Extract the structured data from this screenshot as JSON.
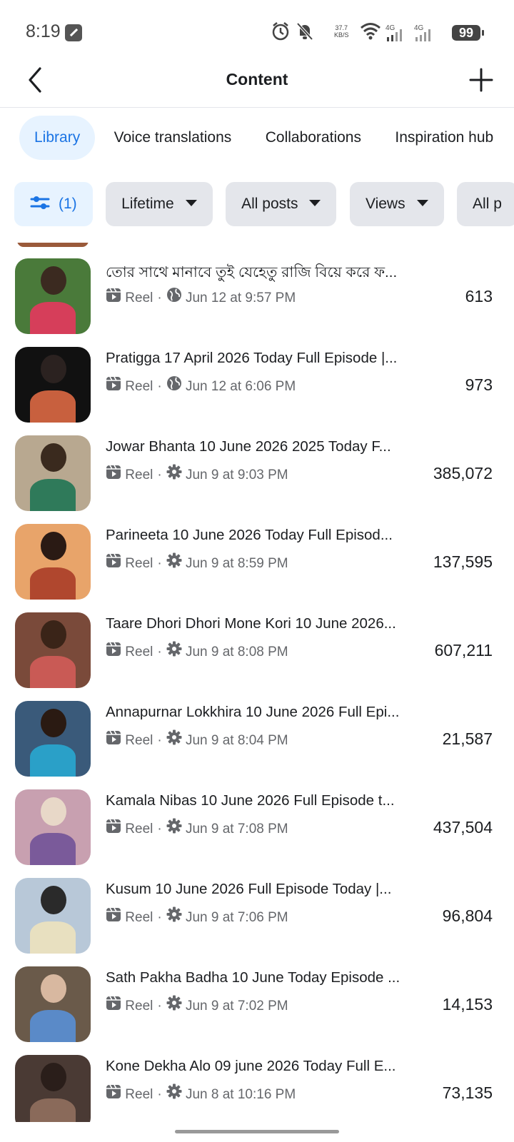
{
  "status_bar": {
    "time": "8:19",
    "net_speed_value": "37.7",
    "net_speed_unit": "KB/S",
    "net1": "4G",
    "net2": "4G",
    "battery": "99"
  },
  "header": {
    "title": "Content"
  },
  "tabs": [
    {
      "label": "Library",
      "active": true
    },
    {
      "label": "Voice translations"
    },
    {
      "label": "Collaborations"
    },
    {
      "label": "Inspiration hub"
    }
  ],
  "filters": {
    "filter_count": "(1)",
    "chips": [
      {
        "label": "Lifetime"
      },
      {
        "label": "All posts"
      },
      {
        "label": "Views"
      },
      {
        "label": "All p"
      }
    ]
  },
  "posts": [
    {
      "title": "তোর সাথে মানাবে তুই যেহেতু রাজি বিয়ে করে ফ...",
      "type": "Reel",
      "privacy_icon": "globe-icon",
      "date": "Jun 12 at 9:57 PM",
      "views": "613"
    },
    {
      "title": "Pratigga 17 April 2026 Today Full Episode |...",
      "type": "Reel",
      "privacy_icon": "globe-icon",
      "date": "Jun 12 at 6:06 PM",
      "views": "973"
    },
    {
      "title": "Jowar Bhanta 10 June  2026 2025 Today F...",
      "type": "Reel",
      "privacy_icon": "gear-icon",
      "date": "Jun 9 at 9:03 PM",
      "views": "385,072"
    },
    {
      "title": "Parineeta  10 June 2026 Today Full Episod...",
      "type": "Reel",
      "privacy_icon": "gear-icon",
      "date": "Jun 9 at 8:59 PM",
      "views": "137,595"
    },
    {
      "title": "Taare Dhori Dhori Mone Kori 10 June 2026...",
      "type": "Reel",
      "privacy_icon": "gear-icon",
      "date": "Jun 9 at 8:08 PM",
      "views": "607,211"
    },
    {
      "title": "Annapurnar Lokkhira 10 June 2026 Full Epi...",
      "type": "Reel",
      "privacy_icon": "gear-icon",
      "date": "Jun 9 at 8:04 PM",
      "views": "21,587"
    },
    {
      "title": "Kamala Nibas 10 June 2026 Full Episode t...",
      "type": "Reel",
      "privacy_icon": "gear-icon",
      "date": "Jun 9 at 7:08 PM",
      "views": "437,504"
    },
    {
      "title": "Kusum  10 June 2026 Full Episode Today |...",
      "type": "Reel",
      "privacy_icon": "gear-icon",
      "date": "Jun 9 at 7:06 PM",
      "views": "96,804"
    },
    {
      "title": "Sath Pakha Badha  10 June Today Episode ...",
      "type": "Reel",
      "privacy_icon": "gear-icon",
      "date": "Jun 9 at 7:02 PM",
      "views": "14,153"
    },
    {
      "title": "Kone Dekha Alo  09 june 2026 Today Full E...",
      "type": "Reel",
      "privacy_icon": "gear-icon",
      "date": "Jun 8 at 10:16 PM",
      "views": "73,135"
    }
  ],
  "thumb_colors": [
    [
      "#4a7a3a",
      "#d63e5a",
      "#3b2a20"
    ],
    [
      "#111111",
      "#c8603e",
      "#2b2220"
    ],
    [
      "#b8a890",
      "#2f7a5a",
      "#3a2a1e"
    ],
    [
      "#e8a46a",
      "#b0472e",
      "#2a1a14"
    ],
    [
      "#7a4a3a",
      "#c95a55",
      "#3a2418"
    ],
    [
      "#3a5a7a",
      "#2aa0c8",
      "#2a1a12"
    ],
    [
      "#c8a0b0",
      "#7a5a9a",
      "#e8d8c8"
    ],
    [
      "#b8c8d8",
      "#e8e0c0",
      "#2a2a2a"
    ],
    [
      "#6a5a4a",
      "#5a8ac8",
      "#d8b8a0"
    ],
    [
      "#4a3a34",
      "#8a6a5a",
      "#2a1e1a"
    ]
  ]
}
